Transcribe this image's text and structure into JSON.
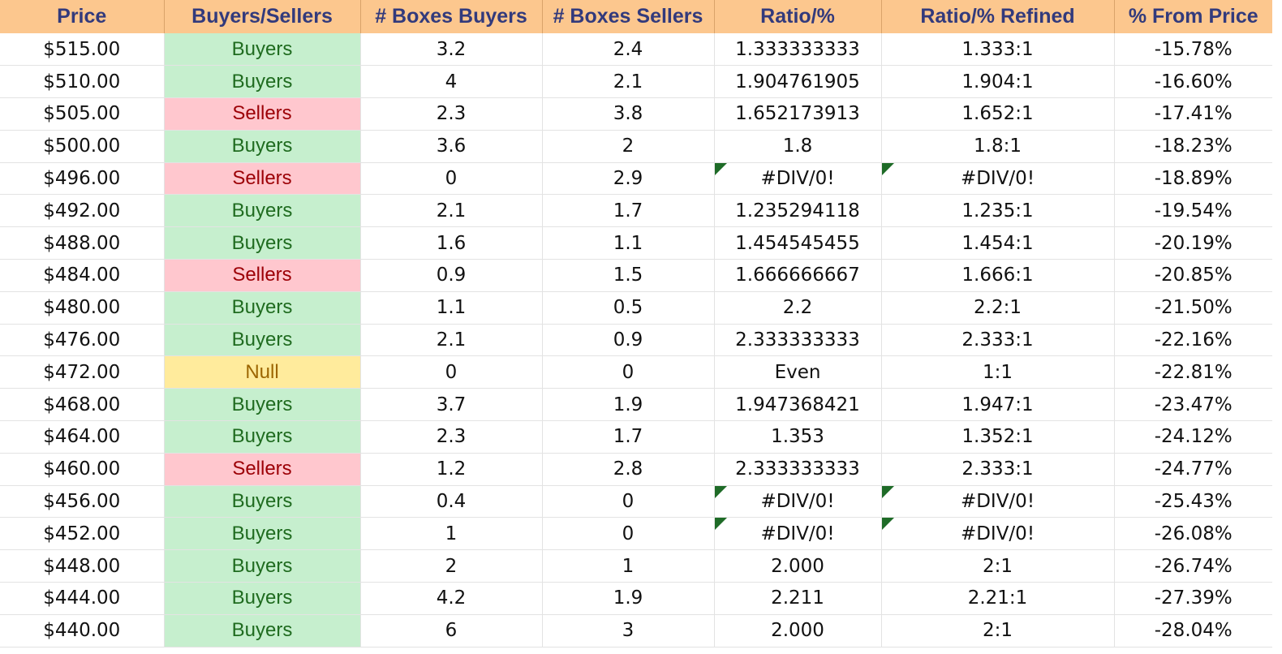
{
  "sheet": {
    "headers": [
      "Price",
      "Buyers/Sellers",
      "# Boxes Buyers",
      "# Boxes Sellers",
      "Ratio/%",
      "Ratio/% Refined",
      "% From Price"
    ],
    "rows": [
      {
        "price": "$515.00",
        "side": "Buyers",
        "buyers": "3.2",
        "sellers": "2.4",
        "ratio": "1.333333333",
        "refined": "1.333:1",
        "pct": "-15.78%"
      },
      {
        "price": "$510.00",
        "side": "Buyers",
        "buyers": "4",
        "sellers": "2.1",
        "ratio": "1.904761905",
        "refined": "1.904:1",
        "pct": "-16.60%"
      },
      {
        "price": "$505.00",
        "side": "Sellers",
        "buyers": "2.3",
        "sellers": "3.8",
        "ratio": "1.652173913",
        "refined": "1.652:1",
        "pct": "-17.41%"
      },
      {
        "price": "$500.00",
        "side": "Buyers",
        "buyers": "3.6",
        "sellers": "2",
        "ratio": "1.8",
        "refined": "1.8:1",
        "pct": "-18.23%"
      },
      {
        "price": "$496.00",
        "side": "Sellers",
        "buyers": "0",
        "sellers": "2.9",
        "ratio": "#DIV/0!",
        "refined": "#DIV/0!",
        "pct": "-18.89%"
      },
      {
        "price": "$492.00",
        "side": "Buyers",
        "buyers": "2.1",
        "sellers": "1.7",
        "ratio": "1.235294118",
        "refined": "1.235:1",
        "pct": "-19.54%"
      },
      {
        "price": "$488.00",
        "side": "Buyers",
        "buyers": "1.6",
        "sellers": "1.1",
        "ratio": "1.454545455",
        "refined": "1.454:1",
        "pct": "-20.19%"
      },
      {
        "price": "$484.00",
        "side": "Sellers",
        "buyers": "0.9",
        "sellers": "1.5",
        "ratio": "1.666666667",
        "refined": "1.666:1",
        "pct": "-20.85%"
      },
      {
        "price": "$480.00",
        "side": "Buyers",
        "buyers": "1.1",
        "sellers": "0.5",
        "ratio": "2.2",
        "refined": "2.2:1",
        "pct": "-21.50%"
      },
      {
        "price": "$476.00",
        "side": "Buyers",
        "buyers": "2.1",
        "sellers": "0.9",
        "ratio": "2.333333333",
        "refined": "2.333:1",
        "pct": "-22.16%"
      },
      {
        "price": "$472.00",
        "side": "Null",
        "buyers": "0",
        "sellers": "0",
        "ratio": "Even",
        "refined": "1:1",
        "pct": "-22.81%"
      },
      {
        "price": "$468.00",
        "side": "Buyers",
        "buyers": "3.7",
        "sellers": "1.9",
        "ratio": "1.947368421",
        "refined": "1.947:1",
        "pct": "-23.47%"
      },
      {
        "price": "$464.00",
        "side": "Buyers",
        "buyers": "2.3",
        "sellers": "1.7",
        "ratio": "1.353",
        "refined": "1.352:1",
        "pct": "-24.12%"
      },
      {
        "price": "$460.00",
        "side": "Sellers",
        "buyers": "1.2",
        "sellers": "2.8",
        "ratio": "2.333333333",
        "refined": "2.333:1",
        "pct": "-24.77%"
      },
      {
        "price": "$456.00",
        "side": "Buyers",
        "buyers": "0.4",
        "sellers": "0",
        "ratio": "#DIV/0!",
        "refined": "#DIV/0!",
        "pct": "-25.43%"
      },
      {
        "price": "$452.00",
        "side": "Buyers",
        "buyers": "1",
        "sellers": "0",
        "ratio": "#DIV/0!",
        "refined": "#DIV/0!",
        "pct": "-26.08%"
      },
      {
        "price": "$448.00",
        "side": "Buyers",
        "buyers": "2",
        "sellers": "1",
        "ratio": "2.000",
        "refined": "2:1",
        "pct": "-26.74%"
      },
      {
        "price": "$444.00",
        "side": "Buyers",
        "buyers": "4.2",
        "sellers": "1.9",
        "ratio": "2.211",
        "refined": "2.21:1",
        "pct": "-27.39%"
      },
      {
        "price": "$440.00",
        "side": "Buyers",
        "buyers": "6",
        "sellers": "3",
        "ratio": "2.000",
        "refined": "2:1",
        "pct": "-28.04%"
      }
    ]
  },
  "colors": {
    "header_bg": "#fcc78e",
    "header_text": "#323a7c",
    "buyers_bg": "#c6efce",
    "buyers_text": "#1f6b1f",
    "sellers_bg": "#ffc7ce",
    "sellers_text": "#9c0006",
    "null_bg": "#ffeb9c",
    "null_text": "#9c6500",
    "error_marker": "#1e6b27"
  }
}
